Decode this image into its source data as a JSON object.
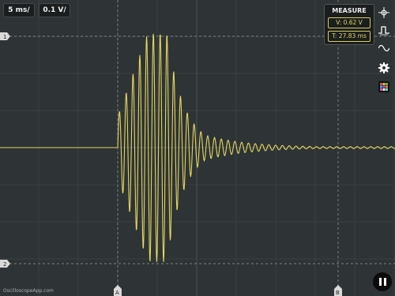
{
  "toolbar": {
    "timebase": "5 ms/",
    "volts_per_div": "0.1 V/"
  },
  "measure": {
    "title": "MEASURE",
    "voltage": "V: 0.62 V",
    "time": "T: 27.83 ms"
  },
  "markers": {
    "level_1": "1",
    "level_2": "2",
    "cursor_a": "A",
    "cursor_b": "B"
  },
  "watermark": "OscilloscopeApp.com",
  "icons": {
    "crosshair": "crosshair-icon",
    "pulse": "pulse-icon",
    "sine": "sine-icon",
    "settings": "gear-icon",
    "color": "color-grid-icon",
    "pause": "pause-icon"
  },
  "colors": {
    "trace": "#e4d75f",
    "grid": "#3f4547",
    "background": "#2e3335"
  }
}
